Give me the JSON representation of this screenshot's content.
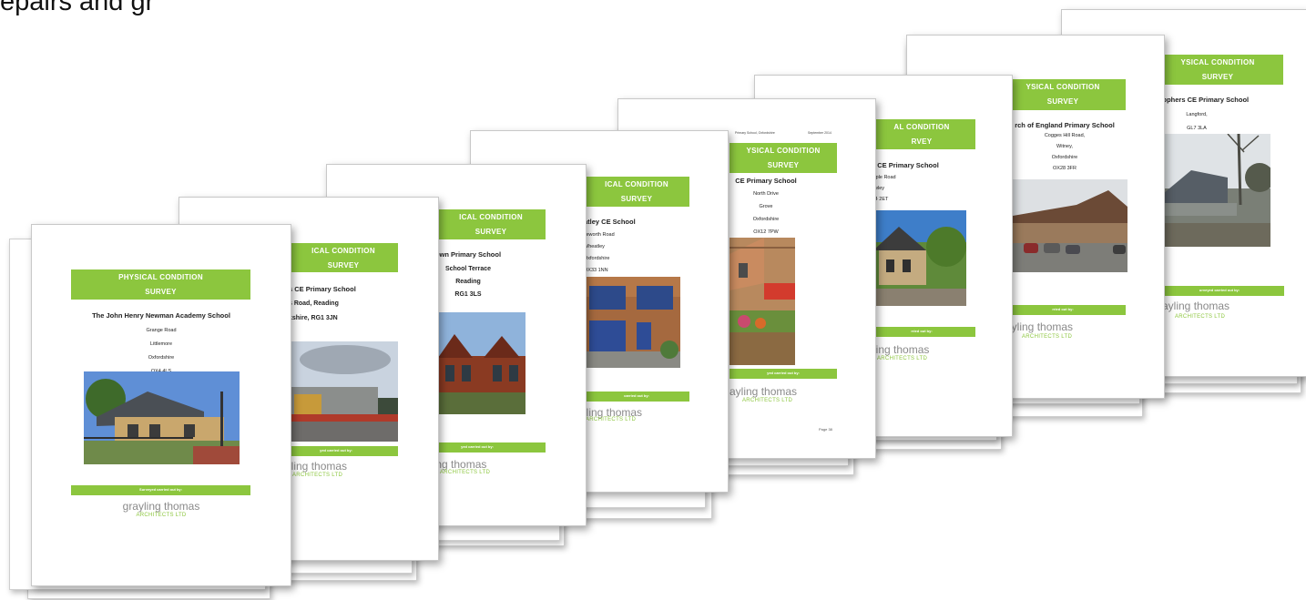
{
  "header_fragment": "epairs and gr",
  "banner": {
    "line1": "Physical Condition",
    "line2": "Survey"
  },
  "surveyed_by_label": "Surveyed carried out by:",
  "logo": {
    "name": "grayling thomas",
    "sub": "ARCHITECTS LTD"
  },
  "documents": [
    {
      "banner1": "Physical Condition",
      "banner2": "Survey",
      "name": "The John Henry Newman Academy School",
      "lines": [
        "Grange Road",
        "Littlemore",
        "Oxfordshire",
        "OX4 4LS"
      ],
      "bar": "Surveyed carried out by:",
      "logo1": "grayling thomas",
      "logo2": "ARCHITECTS LTD"
    },
    {
      "banner1": "ical Condition",
      "banner2": "Survey",
      "name": "s CE Primary School",
      "lines": [
        "s Road, Reading",
        "kshire, RG1 3JN"
      ],
      "bar": "yed carried out by:",
      "logo1": "ayling thomas",
      "logo2": "ARCHITECTS LTD"
    },
    {
      "banner1": "ical Condition",
      "banner2": "Survey",
      "name": "own Primary School",
      "lines": [
        "School Terrace",
        "Reading",
        "RG1 3LS"
      ],
      "bar": "yed carried out by:",
      "logo1": "yling thomas",
      "logo2": "ARCHITECTS LTD"
    },
    {
      "banner1": "ical Condition",
      "banner2": "Survey",
      "name": "atley CE School",
      "lines": [
        "lleworth Road",
        "Wheatley",
        "Oxfordshire",
        "OX33 1NN"
      ],
      "bar": "carried out by:",
      "logo1": "lling thomas",
      "logo2": "ARCHITECTS LTD"
    },
    {
      "header_left": "Physical Condition Survey",
      "header_mid": "Primary School, Oxfordshire",
      "header_right": "September 2014",
      "banner1": "ysical Condition",
      "banner2": "Survey",
      "name": "CE Primary School",
      "lines": [
        "North Drive",
        "Grove",
        "Oxfordshire",
        "OX12 7PW"
      ],
      "bar": "yed carried out by:",
      "logo1": "ayling thomas",
      "logo2": "ARCHITECTS LTD",
      "page_no": "Page 38"
    },
    {
      "banner1": "al Condition",
      "banner2": "rvey",
      "name": "s CE Primary School",
      "lines": [
        "mple Road",
        "owley",
        "X4 2ET"
      ],
      "bar": "rried out by:",
      "logo1": "ling thomas",
      "logo2": "ARCHITECTS LTD"
    },
    {
      "banner1": "ysical Condition",
      "banner2": "Survey",
      "name": "rch of England Primary School",
      "lines": [
        "Cogges Hill Road,",
        "Witney,",
        "Oxfordshire",
        "OX28 3FR"
      ],
      "bar": "rried out by:",
      "logo1": "ayling thomas",
      "logo2": "ARCHITECTS LTD"
    },
    {
      "banner1": "ysical Condition",
      "banner2": "Survey",
      "name": "tophers CE Primary School",
      "lines": [
        "Langford,",
        "GL7 3LA"
      ],
      "bar": "urveyed carried out by:",
      "logo1": "ayling thomas",
      "logo2": "ARCHITECTS LTD"
    }
  ]
}
